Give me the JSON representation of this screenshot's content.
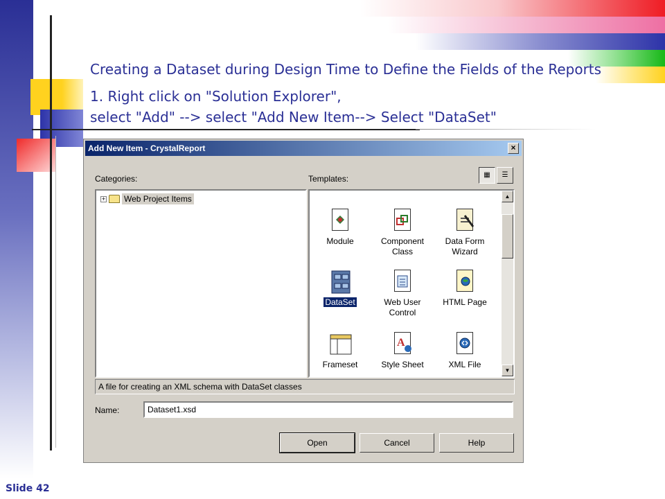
{
  "slide": {
    "title": "Creating a Dataset during Design Time to Define the Fields of the Reports",
    "step_line1": "1. Right click on \"Solution Explorer\",",
    "step_line2": "select \"Add\" --> select \"Add New Item--> Select \"DataSet\"",
    "slide_number": "Slide 42"
  },
  "dialog": {
    "title": "Add New Item - CrystalReport",
    "close_symbol": "×",
    "categories_label": "Categories:",
    "templates_label": "Templates:",
    "category_tree": [
      {
        "label": "Web Project Items",
        "expander": "+",
        "icon": "folder-icon"
      }
    ],
    "view_buttons": [
      {
        "icon": "large-icons-view-icon",
        "glyph": "▦",
        "active": true
      },
      {
        "icon": "list-view-icon",
        "glyph": "☰",
        "active": false
      }
    ],
    "templates": [
      {
        "label": "Module",
        "icon": "module-icon",
        "selected": false
      },
      {
        "label": "Component Class",
        "icon": "component-class-icon",
        "selected": false
      },
      {
        "label": "Data Form Wizard",
        "icon": "data-form-wizard-icon",
        "selected": false
      },
      {
        "label": "DataSet",
        "icon": "dataset-icon",
        "selected": true
      },
      {
        "label": "Web User Control",
        "icon": "web-user-control-icon",
        "selected": false
      },
      {
        "label": "HTML Page",
        "icon": "html-page-icon",
        "selected": false
      },
      {
        "label": "Frameset",
        "icon": "frameset-icon",
        "selected": false
      },
      {
        "label": "Style Sheet",
        "icon": "style-sheet-icon",
        "selected": false
      },
      {
        "label": "XML File",
        "icon": "xml-file-icon",
        "selected": false
      }
    ],
    "description": "A file for creating an XML schema with DataSet classes",
    "name_label": "Name:",
    "name_value": "Dataset1.xsd",
    "buttons": {
      "open": "Open",
      "cancel": "Cancel",
      "help": "Help"
    },
    "colors": {
      "titlebar_start": "#0a246a",
      "titlebar_end": "#a6caf0",
      "face": "#d4d0c8",
      "selection": "#0a246a"
    }
  }
}
